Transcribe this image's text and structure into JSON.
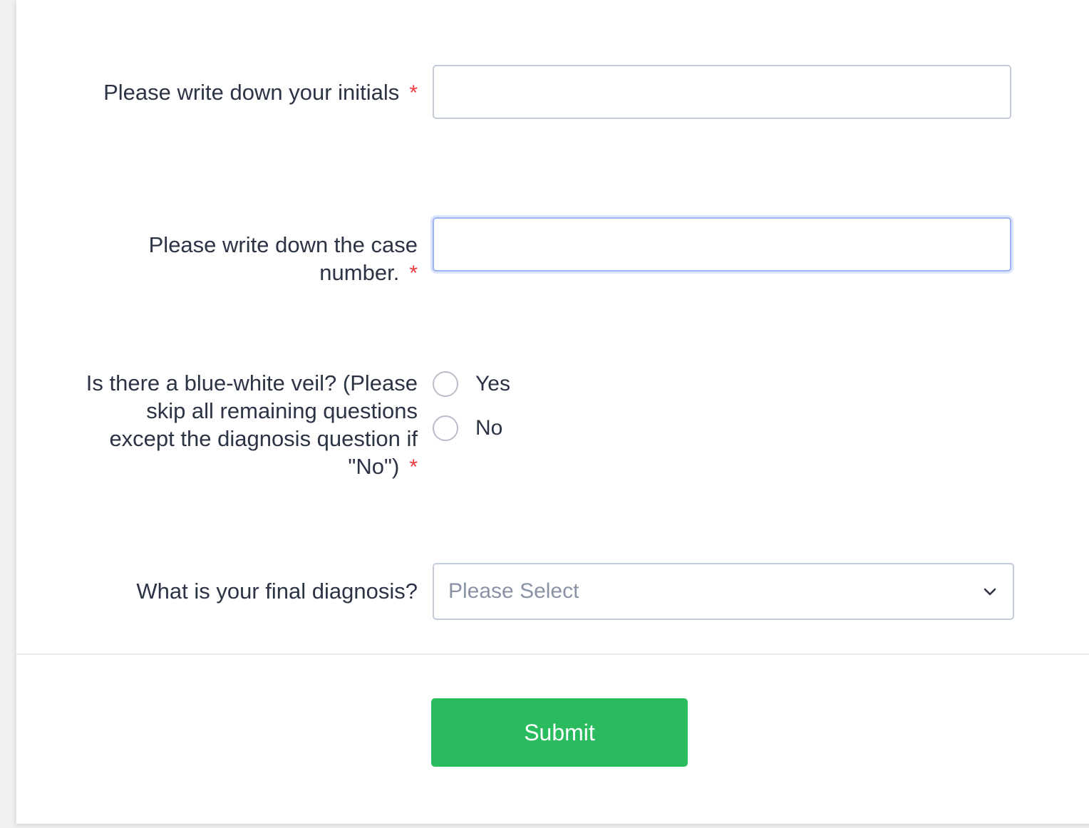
{
  "form": {
    "fields": [
      {
        "label": "Please write down your initials",
        "required_mark": "*",
        "value": "",
        "placeholder": ""
      },
      {
        "label": "Please write down the case number.",
        "required_mark": "*",
        "value": "",
        "placeholder": ""
      }
    ],
    "veil_question": {
      "label": "Is there a blue-white veil? (Please skip all remaining questions except the diagnosis question if \"No\")",
      "required_mark": "*",
      "options": [
        "Yes",
        "No"
      ]
    },
    "diagnosis": {
      "label": "What is your final diagnosis?",
      "selected": "Please Select"
    },
    "submit_label": "Submit"
  },
  "colors": {
    "accent_green": "#2abb5e",
    "required_red": "#f23a3c",
    "focus_blue": "#9db4f2",
    "text": "#2c3345"
  },
  "icons": {
    "select_indicator": "chevron-down-icon"
  }
}
